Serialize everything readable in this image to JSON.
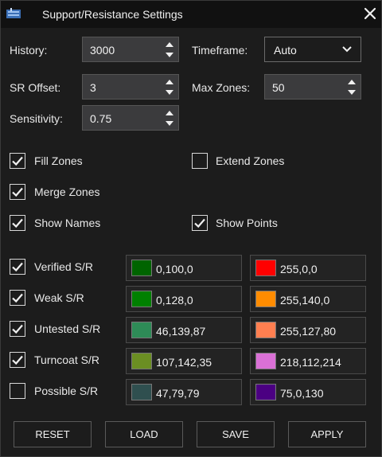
{
  "window": {
    "title": "Support/Resistance Settings",
    "app_icon": "chart-app-icon",
    "close_icon": "close-icon"
  },
  "fields": {
    "history": {
      "label": "History:",
      "value": "3000"
    },
    "sr_offset": {
      "label": "SR Offset:",
      "value": "3"
    },
    "sensitivity": {
      "label": "Sensitivity:",
      "value": "0.75"
    },
    "timeframe": {
      "label": "Timeframe:",
      "value": "Auto"
    },
    "max_zones": {
      "label": "Max Zones:",
      "value": "50"
    }
  },
  "options": {
    "fill_zones": {
      "label": "Fill Zones",
      "checked": true
    },
    "extend_zones": {
      "label": "Extend Zones",
      "checked": false
    },
    "merge_zones": {
      "label": "Merge Zones",
      "checked": true
    },
    "show_names": {
      "label": "Show Names",
      "checked": true
    },
    "show_points": {
      "label": "Show Points",
      "checked": true
    }
  },
  "zones": [
    {
      "label": "Verified S/R",
      "checked": true,
      "support": "0,100,0",
      "support_color": "#006400",
      "resistance": "255,0,0",
      "resistance_color": "#ff0000"
    },
    {
      "label": "Weak S/R",
      "checked": true,
      "support": "0,128,0",
      "support_color": "#008000",
      "resistance": "255,140,0",
      "resistance_color": "#ff8c00"
    },
    {
      "label": "Untested S/R",
      "checked": true,
      "support": "46,139,87",
      "support_color": "#2e8b57",
      "resistance": "255,127,80",
      "resistance_color": "#ff7f50"
    },
    {
      "label": "Turncoat S/R",
      "checked": true,
      "support": "107,142,35",
      "support_color": "#6b8e23",
      "resistance": "218,112,214",
      "resistance_color": "#da70d6"
    },
    {
      "label": "Possible S/R",
      "checked": false,
      "support": "47,79,79",
      "support_color": "#2f4f4f",
      "resistance": "75,0,130",
      "resistance_color": "#4b0082"
    }
  ],
  "buttons": {
    "reset": "RESET",
    "load": "LOAD",
    "save": "SAVE",
    "apply": "APPLY"
  }
}
